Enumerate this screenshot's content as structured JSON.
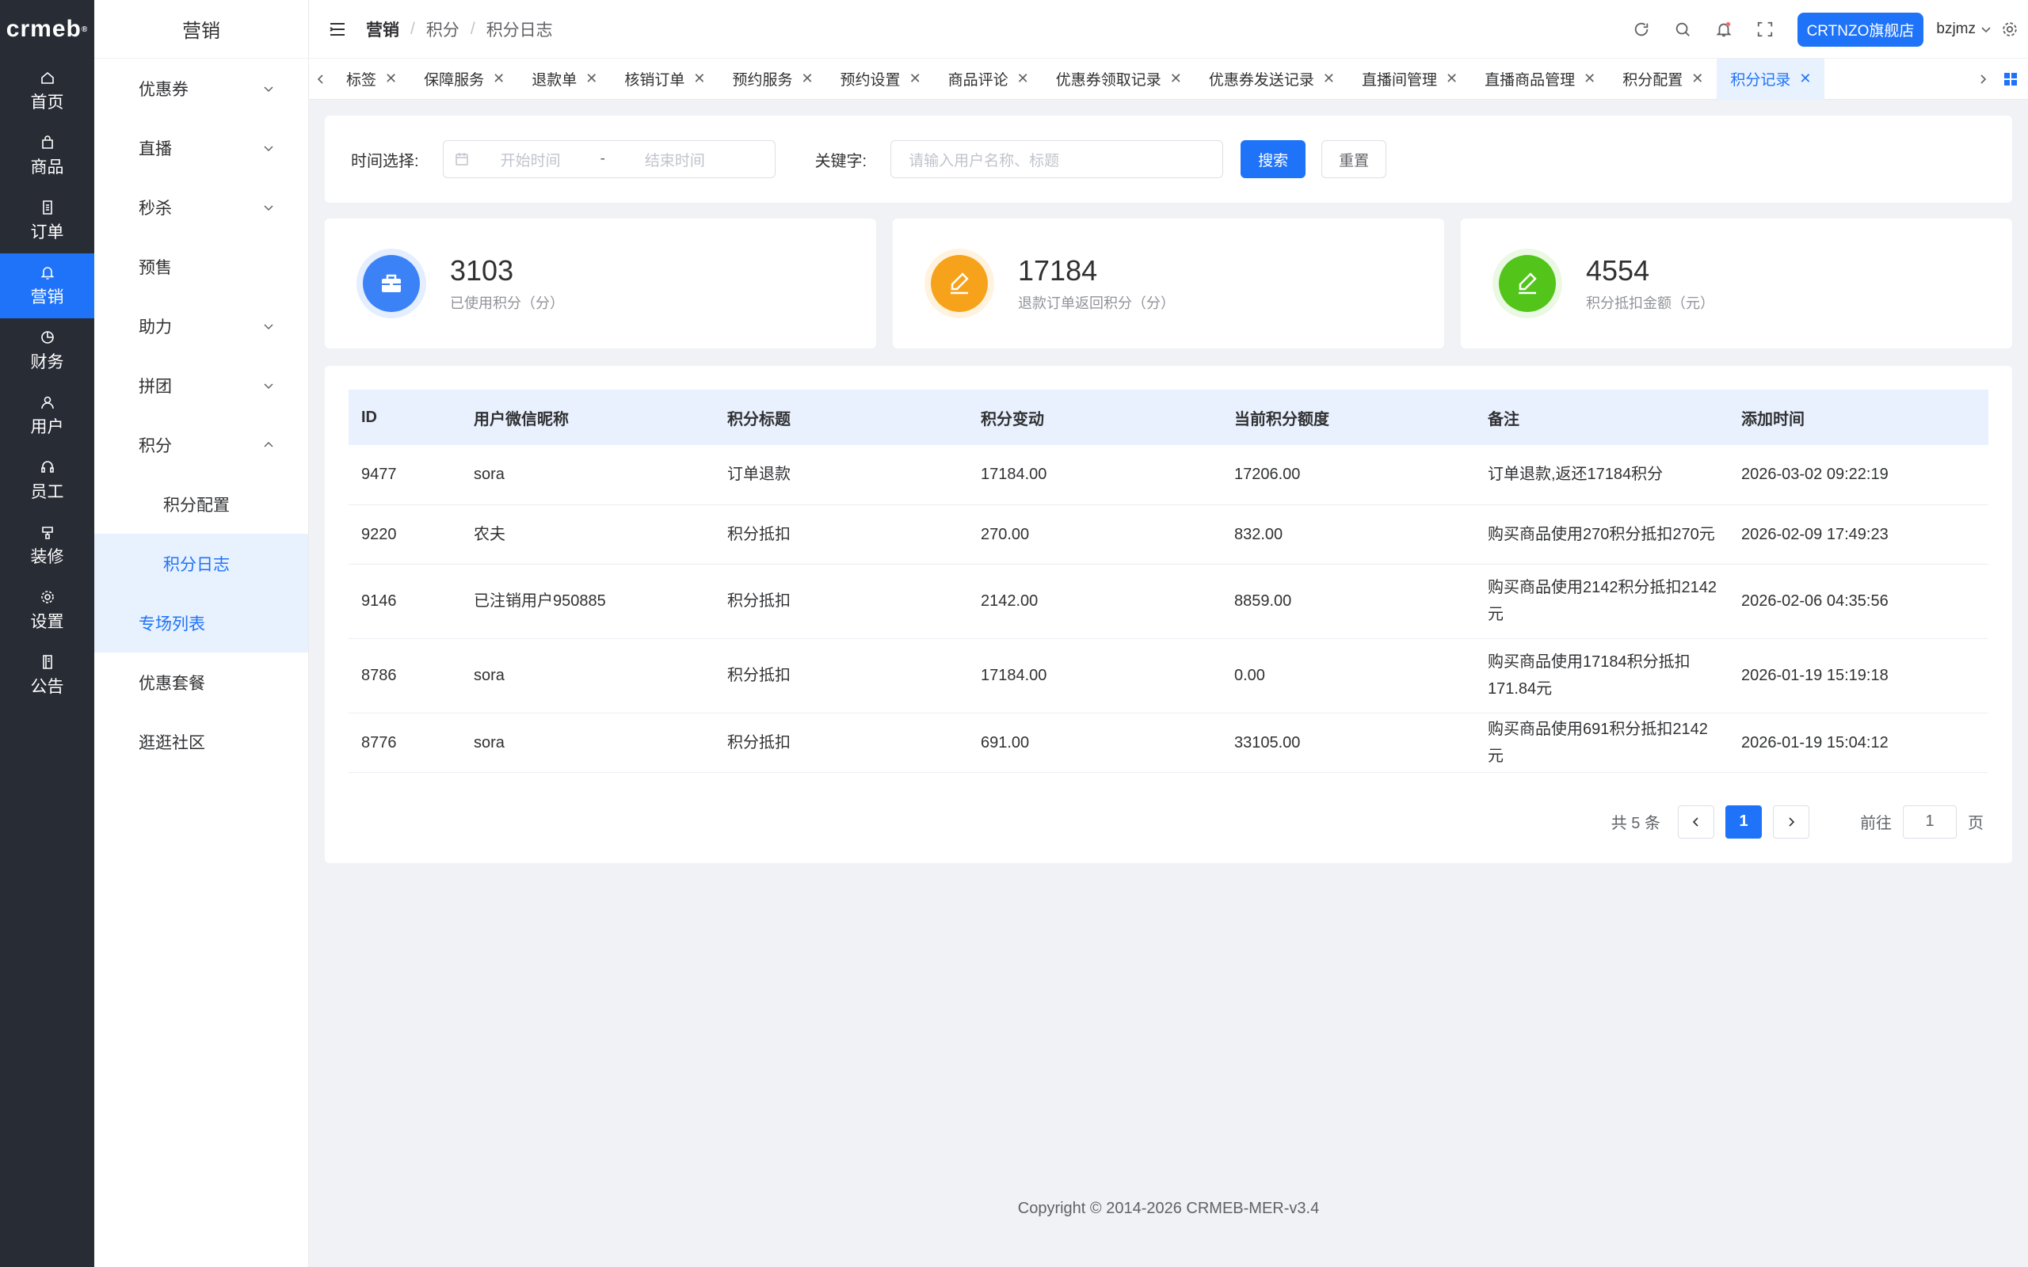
{
  "brand": {
    "logo_text": "crmeb"
  },
  "rail": {
    "items": [
      {
        "label": "首页",
        "icon": "home-icon"
      },
      {
        "label": "商品",
        "icon": "bag-icon"
      },
      {
        "label": "订单",
        "icon": "document-icon"
      },
      {
        "label": "营销",
        "icon": "bell-icon",
        "active": true
      },
      {
        "label": "财务",
        "icon": "pie-icon"
      },
      {
        "label": "用户",
        "icon": "user-icon"
      },
      {
        "label": "员工",
        "icon": "headset-icon"
      },
      {
        "label": "装修",
        "icon": "paint-icon"
      },
      {
        "label": "设置",
        "icon": "gear-icon"
      },
      {
        "label": "公告",
        "icon": "book-icon"
      }
    ]
  },
  "sidebar": {
    "title": "营销",
    "items": [
      {
        "label": "优惠券",
        "expandable": true
      },
      {
        "label": "直播",
        "expandable": true
      },
      {
        "label": "秒杀",
        "expandable": true
      },
      {
        "label": "预售"
      },
      {
        "label": "助力",
        "expandable": true
      },
      {
        "label": "拼团",
        "expandable": true
      },
      {
        "label": "积分",
        "expanded": true
      }
    ],
    "sub_items": [
      {
        "label": "积分配置"
      },
      {
        "label": "积分日志",
        "active": true
      }
    ],
    "after_items": [
      {
        "label": "专场列表"
      },
      {
        "label": "优惠套餐"
      },
      {
        "label": "逛逛社区"
      }
    ]
  },
  "header": {
    "breadcrumb": [
      "营销",
      "积分",
      "积分日志"
    ],
    "store_label": "CRTNZO旗舰店",
    "username": "bzjmz"
  },
  "tabs": [
    {
      "label": "标签"
    },
    {
      "label": "保障服务"
    },
    {
      "label": "退款单"
    },
    {
      "label": "核销订单"
    },
    {
      "label": "预约服务"
    },
    {
      "label": "预约设置"
    },
    {
      "label": "商品评论"
    },
    {
      "label": "优惠券领取记录"
    },
    {
      "label": "优惠券发送记录"
    },
    {
      "label": "直播间管理"
    },
    {
      "label": "直播商品管理"
    },
    {
      "label": "积分配置"
    },
    {
      "label": "积分记录",
      "active": true
    }
  ],
  "filter": {
    "time_label": "时间选择:",
    "start_placeholder": "开始时间",
    "range_sep": "-",
    "end_placeholder": "结束时间",
    "keyword_label": "关键字:",
    "keyword_placeholder": "请输入用户名称、标题",
    "search_label": "搜索",
    "reset_label": "重置"
  },
  "stats": [
    {
      "value": "3103",
      "caption": "已使用积分（分）",
      "color": "#3b82f6",
      "ring": "#e4eefe",
      "icon": "briefcase-icon"
    },
    {
      "value": "17184",
      "caption": "退款订单返回积分（分）",
      "color": "#f7a21b",
      "ring": "#fff3e0",
      "icon": "pen-icon"
    },
    {
      "value": "4554",
      "caption": "积分抵扣金额（元）",
      "color": "#52c41a",
      "ring": "#ebf8e4",
      "icon": "pen-icon"
    }
  ],
  "table": {
    "columns": [
      "ID",
      "用户微信昵称",
      "积分标题",
      "积分变动",
      "当前积分额度",
      "备注",
      "添加时间"
    ],
    "rows": [
      [
        "9477",
        "sora",
        "订单退款",
        "17184.00",
        "17206.00",
        "订单退款,返还17184积分",
        "2026-03-02 09:22:19"
      ],
      [
        "9220",
        "农夫",
        "积分抵扣",
        "270.00",
        "832.00",
        "购买商品使用270积分抵扣270元",
        "2026-02-09 17:49:23"
      ],
      [
        "9146",
        "已注销用户950885",
        "积分抵扣",
        "2142.00",
        "8859.00",
        "购买商品使用2142积分抵扣2142元",
        "2026-02-06 04:35:56"
      ],
      [
        "8786",
        "sora",
        "积分抵扣",
        "17184.00",
        "0.00",
        "购买商品使用17184积分抵扣171.84元",
        "2026-01-19 15:19:18"
      ],
      [
        "8776",
        "sora",
        "积分抵扣",
        "691.00",
        "33105.00",
        "购买商品使用691积分抵扣2142元",
        "2026-01-19 15:04:12"
      ]
    ]
  },
  "pagination": {
    "total_text": "共 5 条",
    "current_page": "1",
    "goto_label": "前往",
    "goto_value": "1",
    "page_suffix": "页"
  },
  "footer": {
    "copyright": "Copyright © 2014-2026 CRMEB-MER-v3.4"
  },
  "colors": {
    "primary": "#1e73f8",
    "rail_bg": "#282c35"
  }
}
